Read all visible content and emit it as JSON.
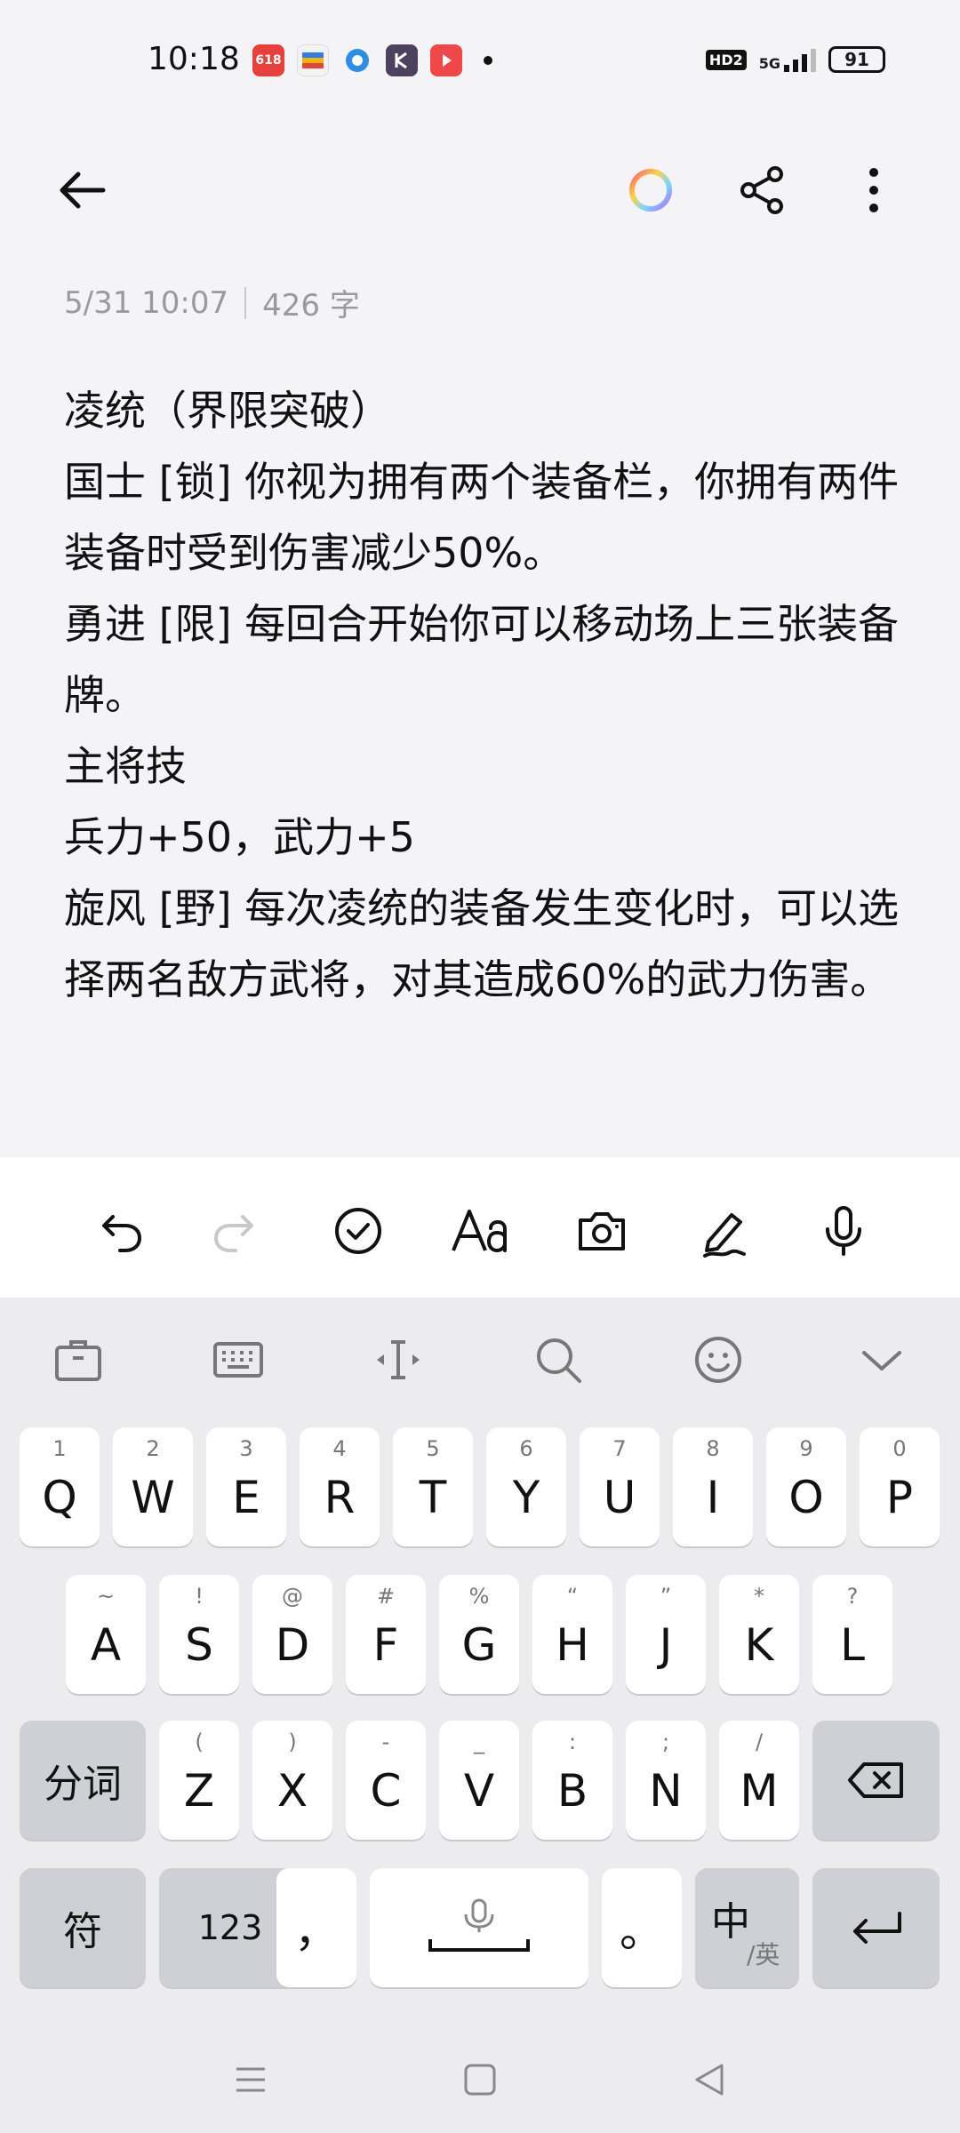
{
  "status": {
    "time": "10:18",
    "notif_badge": "618",
    "network": "5G",
    "hd": "HD2",
    "battery": "91"
  },
  "note": {
    "date": "5/31 10:07",
    "count": "426 字",
    "lines": [
      "凌统（界限突破）",
      "国士 [锁] 你视为拥有两个装备栏，你拥有两件装备时受到伤害减少50%。",
      "勇进 [限] 每回合开始你可以移动场上三张装备牌。",
      "主将技",
      "兵力+50，武力+5",
      "旋风 [野] 每次凌统的装备发生变化时，可以选择两名敌方武将，对其造成60%的武力伤害。"
    ]
  },
  "keyboard": {
    "row1": [
      {
        "k": "Q",
        "h": "1"
      },
      {
        "k": "W",
        "h": "2"
      },
      {
        "k": "E",
        "h": "3"
      },
      {
        "k": "R",
        "h": "4"
      },
      {
        "k": "T",
        "h": "5"
      },
      {
        "k": "Y",
        "h": "6"
      },
      {
        "k": "U",
        "h": "7"
      },
      {
        "k": "I",
        "h": "8"
      },
      {
        "k": "O",
        "h": "9"
      },
      {
        "k": "P",
        "h": "0"
      }
    ],
    "row2": [
      {
        "k": "A",
        "h": "~"
      },
      {
        "k": "S",
        "h": "!"
      },
      {
        "k": "D",
        "h": "@"
      },
      {
        "k": "F",
        "h": "#"
      },
      {
        "k": "G",
        "h": "%"
      },
      {
        "k": "H",
        "h": "“"
      },
      {
        "k": "J",
        "h": "”"
      },
      {
        "k": "K",
        "h": "*"
      },
      {
        "k": "L",
        "h": "?"
      }
    ],
    "row3": [
      {
        "k": "Z",
        "h": "("
      },
      {
        "k": "X",
        "h": ")"
      },
      {
        "k": "C",
        "h": "-"
      },
      {
        "k": "V",
        "h": "_"
      },
      {
        "k": "B",
        "h": ":"
      },
      {
        "k": "N",
        "h": ";"
      },
      {
        "k": "M",
        "h": "/"
      }
    ],
    "fenci": "分词",
    "fu": "符",
    "num": "123",
    "comma": "，",
    "period": "。",
    "lang_main": "中",
    "lang_sub": "/英"
  }
}
